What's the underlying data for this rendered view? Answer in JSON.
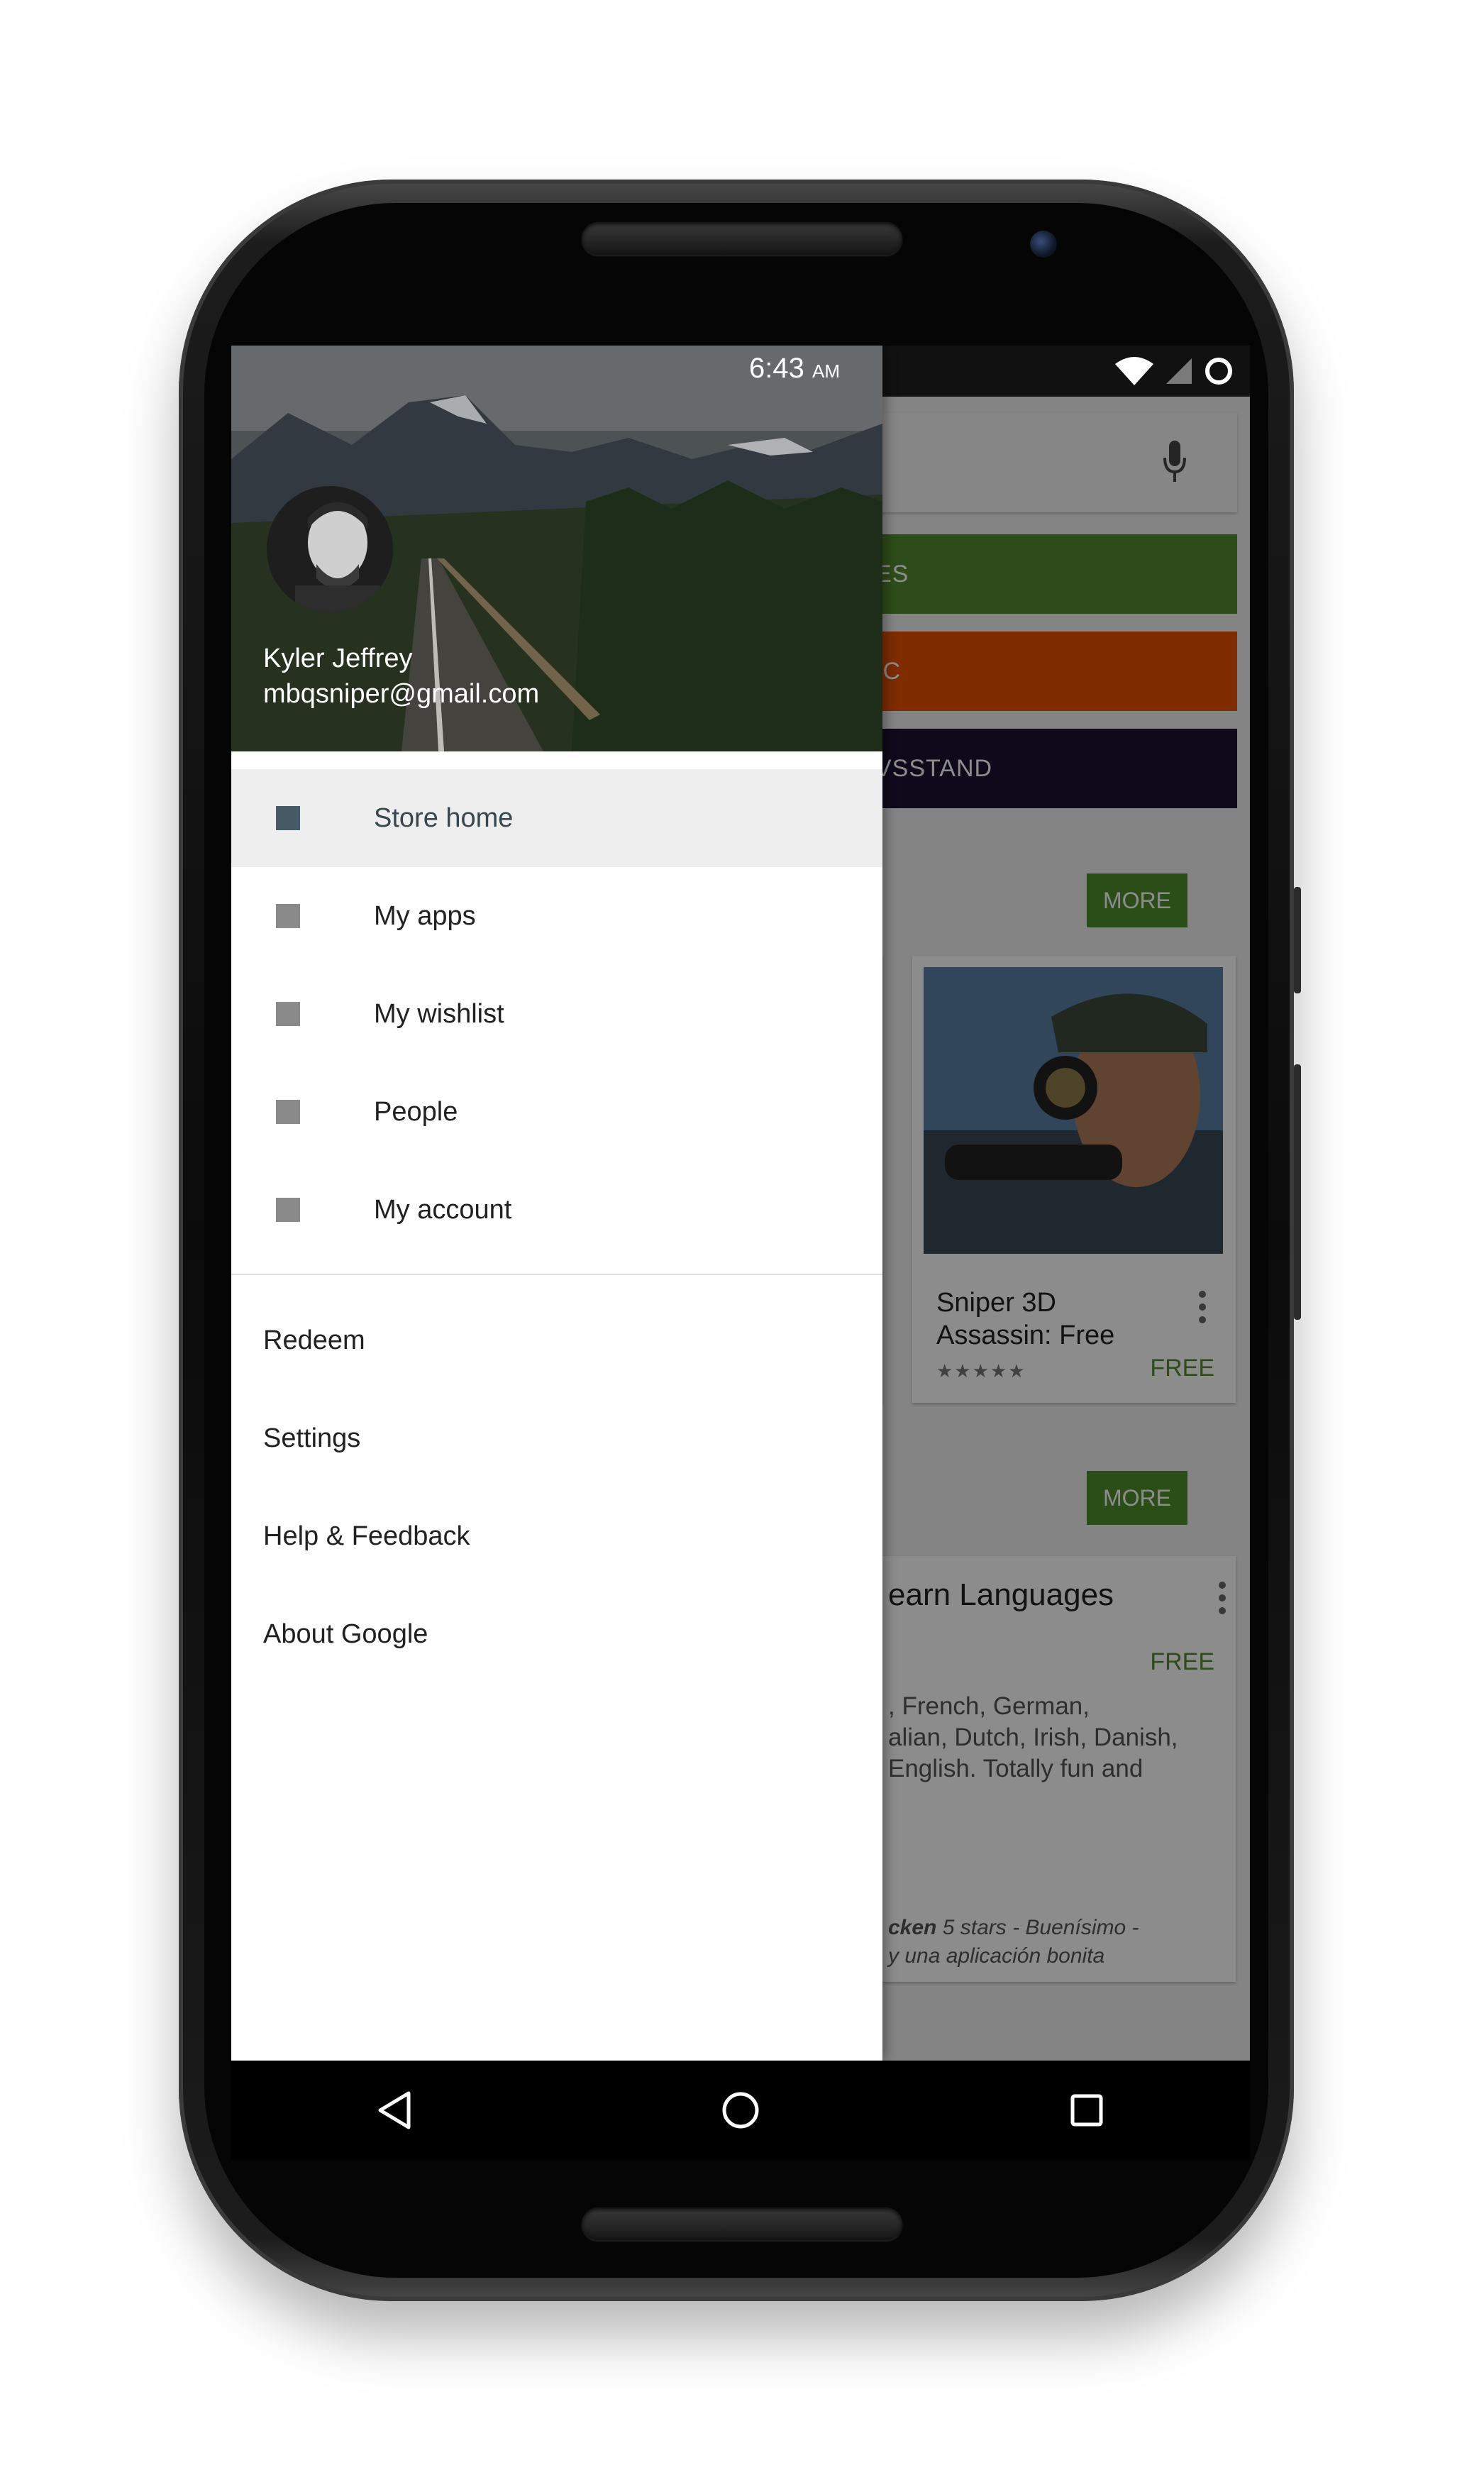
{
  "status_bar": {
    "time": "6:43",
    "ampm": "AM"
  },
  "drawer": {
    "user": {
      "name": "Kyler Jeffrey",
      "email": "mbqsniper@gmail.com"
    },
    "primary_items": [
      {
        "label": "Store home",
        "active": true
      },
      {
        "label": "My apps",
        "active": false
      },
      {
        "label": "My wishlist",
        "active": false
      },
      {
        "label": "People",
        "active": false
      },
      {
        "label": "My account",
        "active": false
      }
    ],
    "secondary_items": [
      {
        "label": "Redeem"
      },
      {
        "label": "Settings"
      },
      {
        "label": "Help & Feedback"
      },
      {
        "label": "About Google"
      }
    ]
  },
  "store": {
    "categories": [
      {
        "label": "ES",
        "color": "#558b2f"
      },
      {
        "label": "IC",
        "color": "#e65100"
      },
      {
        "label": "VSSTAND",
        "color": "#1a1334"
      }
    ],
    "more_label": "MORE",
    "app_card": {
      "title": "Sniper 3D Assassin: Free",
      "price": "FREE",
      "rating": 4.5
    },
    "featured_card": {
      "title": "earn Languages",
      "price": "FREE",
      "description_lines": [
        ", French, German,",
        "alian, Dutch, Irish, Danish,",
        "English. Totally fun and"
      ],
      "review_bold": "cken",
      "review_text": " 5 stars - Buenísimo -",
      "review_line2": "y una aplicación bonita"
    }
  },
  "icons": {
    "wifi": "wifi-icon",
    "signal": "signal-icon",
    "battery": "battery-charging-icon",
    "mic": "mic-icon",
    "back": "back-icon",
    "home": "home-icon",
    "recents": "recents-icon",
    "overflow": "overflow-menu-icon"
  },
  "colors": {
    "accent_green": "#558b2f",
    "active_icon": "#455a64",
    "inactive_icon": "#8a8a8a"
  }
}
